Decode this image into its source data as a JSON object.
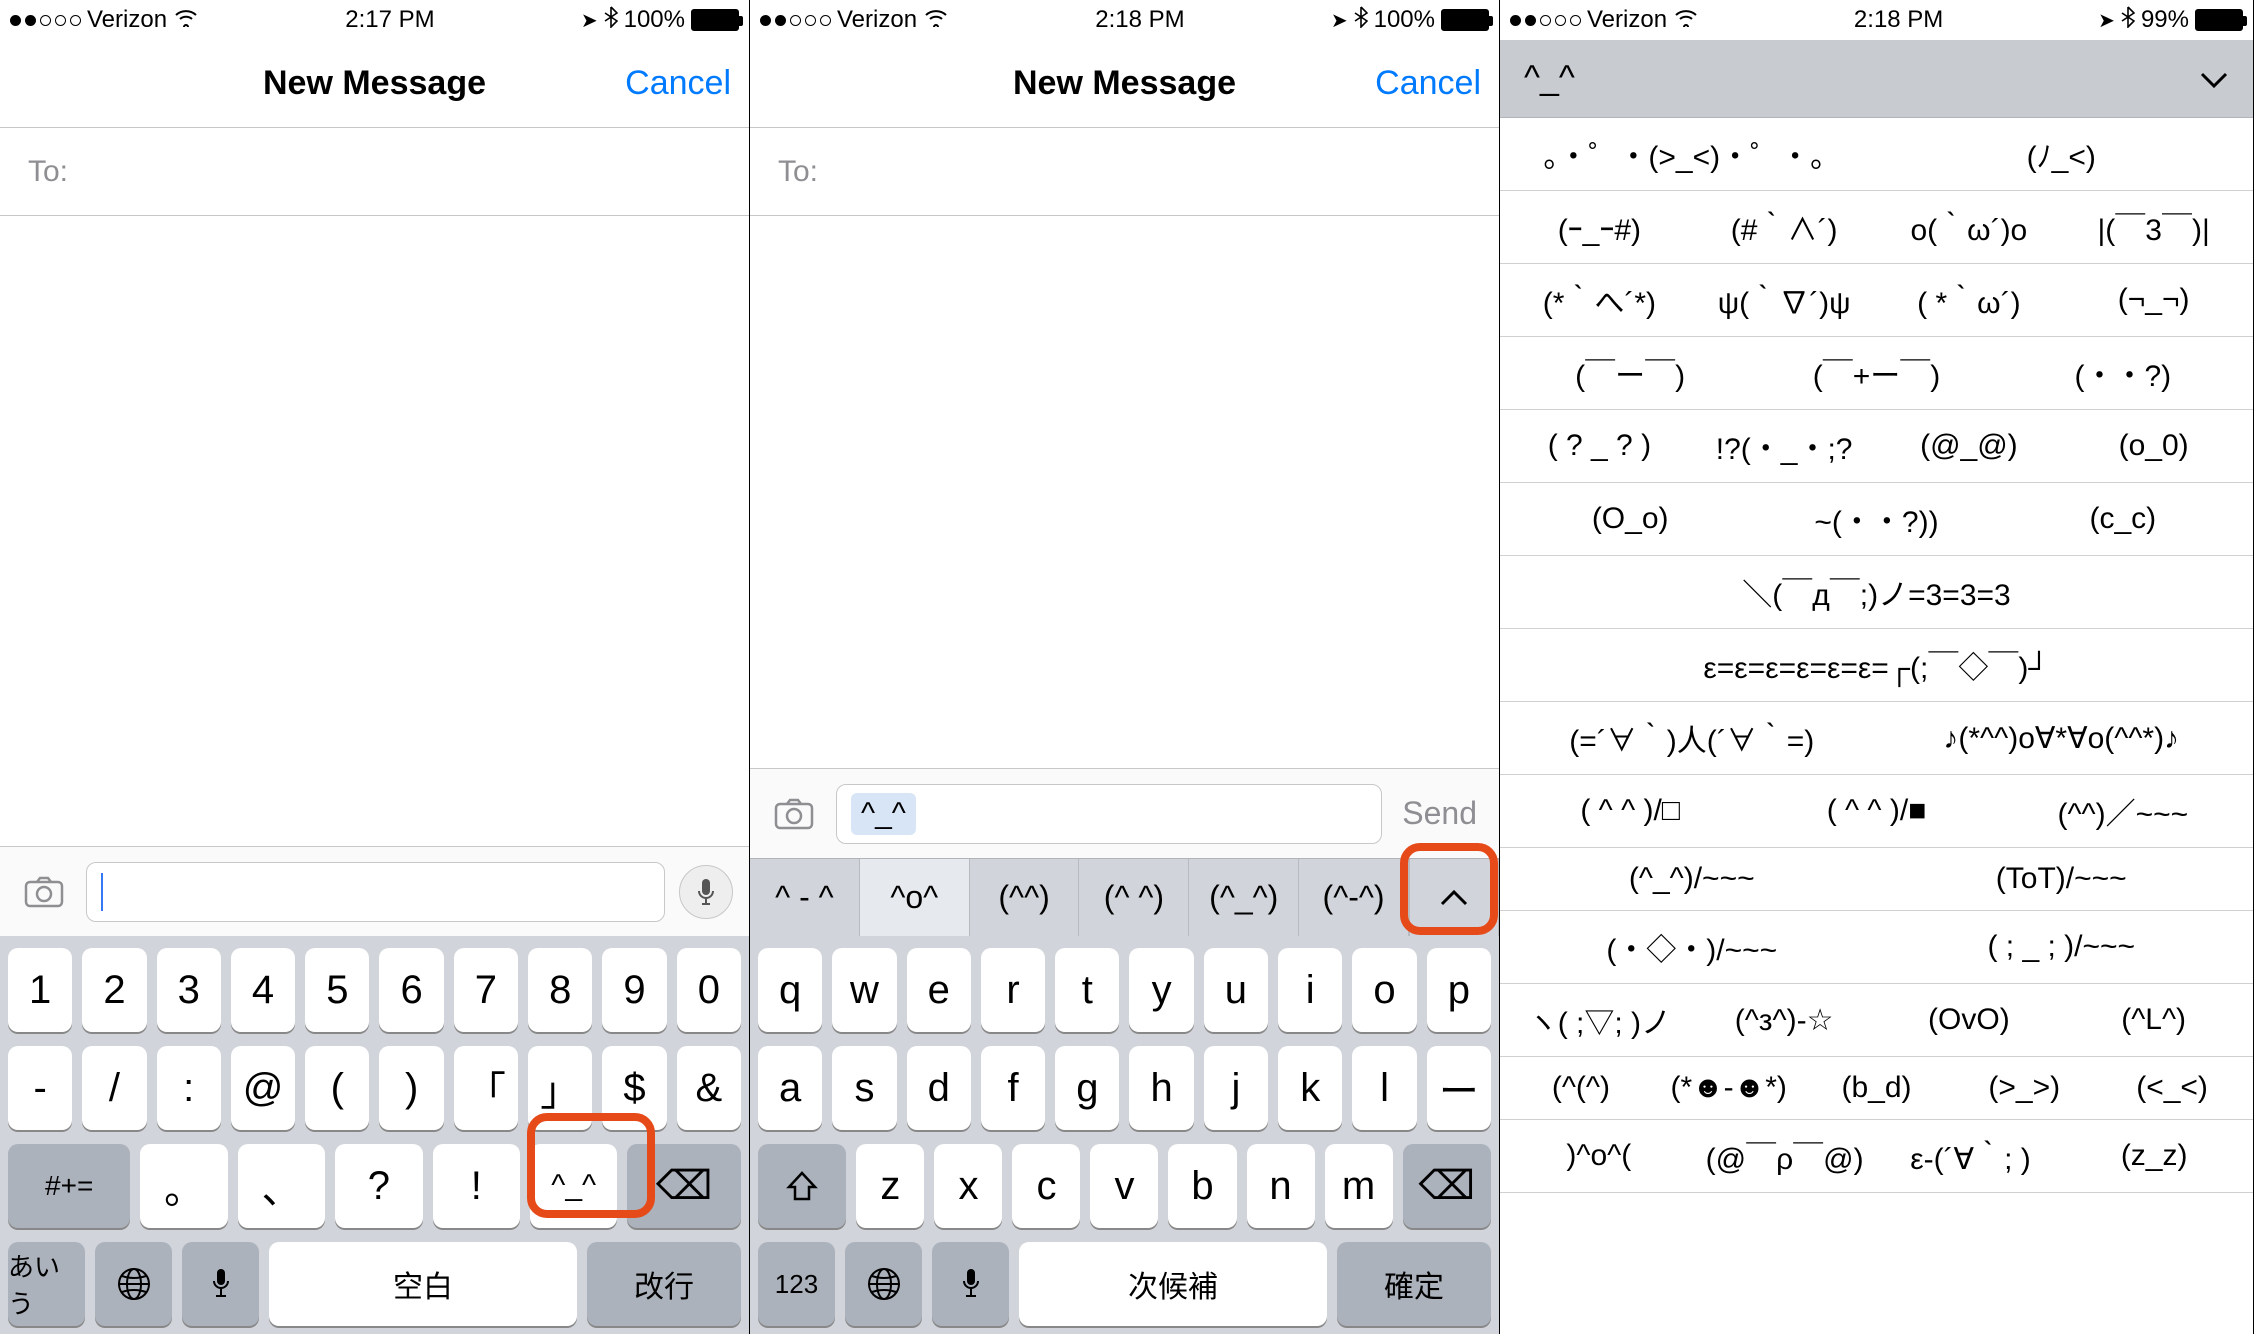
{
  "pane1": {
    "status": {
      "carrier": "Verizon",
      "time": "2:17 PM",
      "battery": "100%"
    },
    "nav": {
      "title": "New Message",
      "cancel": "Cancel"
    },
    "to_label": "To:",
    "keyboard": {
      "row1": [
        "1",
        "2",
        "3",
        "4",
        "5",
        "6",
        "7",
        "8",
        "9",
        "0"
      ],
      "row2": [
        "-",
        "/",
        ":",
        "@",
        "(",
        ")",
        "「",
        "」",
        "$",
        "&"
      ],
      "row3_mode": "#+=",
      "row3": [
        "。",
        "、",
        "?",
        "!",
        "^_^"
      ],
      "row3_del": "⌫",
      "bottom_mode": "あいう",
      "space": "空白",
      "return": "改行"
    }
  },
  "pane2": {
    "status": {
      "carrier": "Verizon",
      "time": "2:18 PM",
      "battery": "100%"
    },
    "nav": {
      "title": "New Message",
      "cancel": "Cancel"
    },
    "to_label": "To:",
    "input_chip": "^_^",
    "send": "Send",
    "candidates": [
      "^ - ^",
      "^o^",
      "(^^)",
      "(^ ^)",
      "(^_^)",
      "(^-^)"
    ],
    "keyboard": {
      "row1": [
        "q",
        "w",
        "e",
        "r",
        "t",
        "y",
        "u",
        "i",
        "o",
        "p"
      ],
      "row2": [
        "a",
        "s",
        "d",
        "f",
        "g",
        "h",
        "j",
        "k",
        "l",
        "ー"
      ],
      "row3": [
        "z",
        "x",
        "c",
        "v",
        "b",
        "n",
        "m"
      ],
      "row3_del": "⌫",
      "bottom_mode": "123",
      "space": "次候補",
      "return": "確定"
    }
  },
  "pane3": {
    "status": {
      "carrier": "Verizon",
      "time": "2:18 PM",
      "battery": "99%"
    },
    "search_text": "^_^",
    "rows": [
      [
        "。・゜・(>_<)・゜・。",
        "(ﾉ_<)"
      ],
      [
        "(ｰ_ｰ#)",
        "(#｀∧´)",
        "o(｀ω´)o",
        "|(￣3￣)|"
      ],
      [
        "(*｀へ´*)",
        "ψ(｀∇´)ψ",
        "( *｀ω´)",
        "(¬_¬)"
      ],
      [
        "(￣ー￣)",
        "(￣+ー￣)",
        "(・・?)"
      ],
      [
        "( ? _ ? )",
        "!?(・_・;?",
        "(@_@)",
        "(o_0)"
      ],
      [
        "(O_o)",
        "~(・・?))",
        "(c_c)"
      ],
      [
        "＼(￣д￣;)ノ=3=3=3"
      ],
      [
        "ε=ε=ε=ε=ε=ε=┌(;￣◇￣)┘"
      ],
      [
        "(=´∀｀)人(´∀｀=)",
        "♪(*^^)o∀*∀o(^^*)♪"
      ],
      [
        "( ^ ^ )/□",
        "( ^ ^ )/■",
        "(^^)／~~~"
      ],
      [
        "(^_^)/~~~",
        "(ToT)/~~~"
      ],
      [
        "(・◇・)/~~~",
        "( ; _ ; )/~~~"
      ],
      [
        "ヽ( ;▽; )ノ",
        "(^з^)-☆",
        "(OvO)",
        "(^L^)"
      ],
      [
        "(^(^)",
        "(*☻-☻*)",
        "(b_d)",
        "(>_>)",
        "(<_<)"
      ],
      [
        ")^o^(",
        "(@￣ρ￣@)",
        "ε-(´∀｀; )",
        "(z_z)"
      ]
    ]
  }
}
